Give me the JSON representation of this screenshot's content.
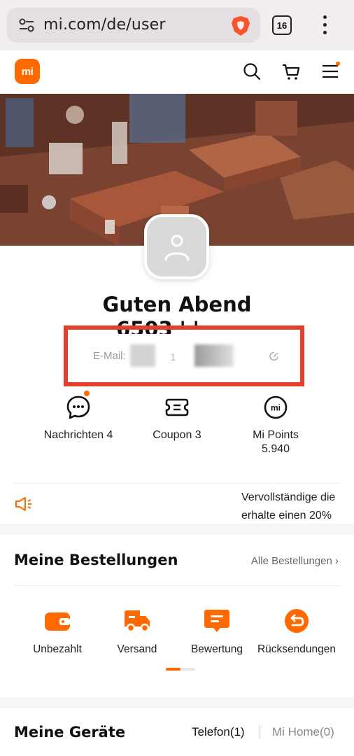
{
  "browser": {
    "url": "mi.com/de/user",
    "tab_count": "16"
  },
  "header": {
    "logo_text": "mi",
    "cart_badge": true
  },
  "profile": {
    "greeting": "Guten Abend",
    "username_visible": "6503 ' '",
    "email_label": "E-Mail:",
    "email_fragment": "1"
  },
  "stats": [
    {
      "label": "Nachrichten 4",
      "value": "",
      "icon": "chat-icon",
      "has_dot": true
    },
    {
      "label": "Coupon 3",
      "value": "",
      "icon": "coupon-icon",
      "has_dot": false
    },
    {
      "label": "Mi Points",
      "value": "5.940",
      "icon": "mi-points-icon",
      "has_dot": false
    }
  ],
  "announcement": {
    "lines": [
      "Vervollständige die",
      "erhalte einen 20%"
    ]
  },
  "orders": {
    "title": "Meine Bestellungen",
    "all_link": "Alle Bestellungen",
    "items": [
      {
        "label": "Unbezahlt",
        "icon": "wallet-icon"
      },
      {
        "label": "Versand",
        "icon": "truck-icon"
      },
      {
        "label": "Bewertung",
        "icon": "review-icon"
      },
      {
        "label": "Rücksendungen",
        "icon": "return-icon"
      }
    ],
    "pager_fraction": 0.5
  },
  "devices": {
    "title": "Meine Geräte",
    "tabs": [
      "Telefon(1)",
      "Mi Home(0)"
    ]
  },
  "colors": {
    "accent": "#ff6900",
    "highlight": "#e43f2a"
  }
}
